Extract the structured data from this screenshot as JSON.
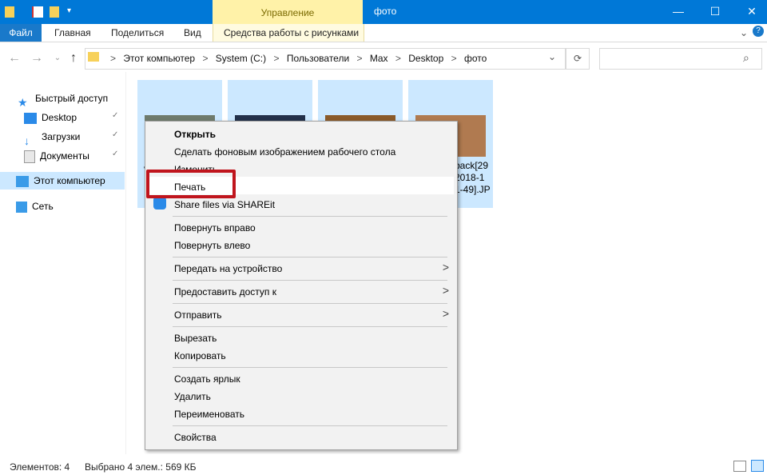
{
  "window": {
    "title": "фото",
    "context_tab": "Управление",
    "controls": {
      "minimize": "—",
      "maximize": "☐",
      "close": "✕"
    }
  },
  "ribbon": {
    "file": "Файл",
    "tabs": [
      "Главная",
      "Поделиться",
      "Вид"
    ],
    "context_subtab": "Средства работы с рисунками",
    "collapse": "⌄",
    "help": "?"
  },
  "address": {
    "crumbs": [
      "Этот компьютер",
      "System (C:)",
      "Пользователи",
      "Max",
      "Desktop",
      "фото"
    ],
    "separator": ">",
    "nav": {
      "back": "←",
      "forward": "→",
      "up": "↑",
      "dropdown": "⌄"
    },
    "refresh": "⟳",
    "search_icon": "⌕"
  },
  "nav_pane": {
    "quick_access": "Быстрый доступ",
    "items": [
      {
        "label": "Desktop",
        "icon": "desktop-icon",
        "pinned": true
      },
      {
        "label": "Загрузки",
        "icon": "download-icon",
        "pinned": true
      },
      {
        "label": "Документы",
        "icon": "documents-icon",
        "pinned": true
      }
    ],
    "this_pc": "Этот компьютер",
    "network": "Сеть",
    "pin_glyph": "📌"
  },
  "files": {
    "tile_label_fragment_left": "v",
    "tile_label_fragment_right": [
      "back[29",
      "2018-1",
      "1-49].JP"
    ]
  },
  "context_menu": {
    "items": [
      {
        "label": "Открыть",
        "bold": true
      },
      {
        "label": "Сделать фоновым изображением рабочего стола"
      },
      {
        "label": "Изменить"
      },
      {
        "label": "Печать",
        "highlighted": true
      },
      {
        "label": "Share files via SHAREit",
        "icon": "shareit-icon"
      },
      {
        "label": "Повернуть вправо"
      },
      {
        "label": "Повернуть влево"
      },
      {
        "label": "Передать на устройство",
        "submenu": true
      },
      {
        "label": "Предоставить доступ к",
        "submenu": true
      },
      {
        "label": "Отправить",
        "submenu": true
      },
      {
        "label": "Вырезать"
      },
      {
        "label": "Копировать"
      },
      {
        "label": "Создать ярлык"
      },
      {
        "label": "Удалить"
      },
      {
        "label": "Переименовать"
      },
      {
        "label": "Свойства"
      }
    ],
    "submenu_glyph": ">"
  },
  "status": {
    "count": "Элементов: 4",
    "selected": "Выбрано 4 элем.: 569 КБ"
  },
  "colors": {
    "titlebar": "#0078d7",
    "context_tab": "#fff2a8",
    "selection": "#cce8ff",
    "highlight_box": "#c0151d"
  }
}
